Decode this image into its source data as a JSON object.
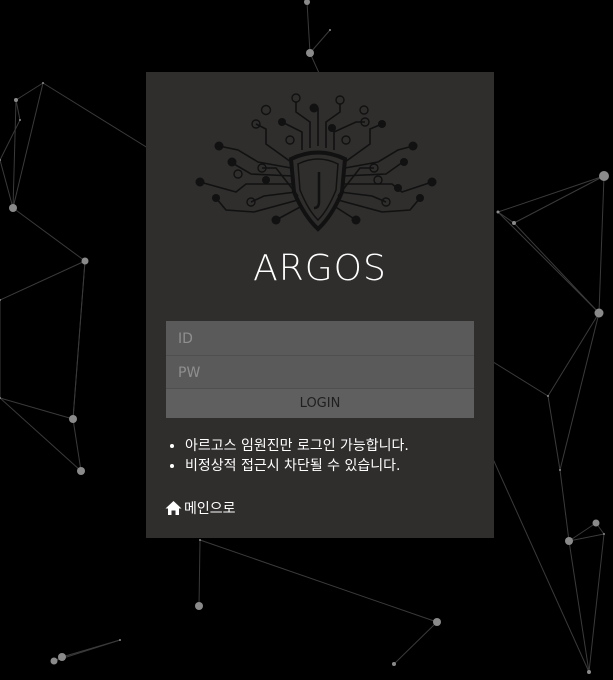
{
  "brand": "ARGOS",
  "login_form": {
    "id_placeholder": "ID",
    "pw_placeholder": "PW",
    "login_label": "LOGIN"
  },
  "notices": [
    "아르고스 임원진만 로그인 가능합니다.",
    "비정상적 접근시 차단될 수 있습니다."
  ],
  "home_link": {
    "icon": "home-icon",
    "label": "메인으로"
  },
  "colors": {
    "page_background": "#000000",
    "panel_background": "#2f2e2d",
    "form_background": "#5a5a5a",
    "text": "#ffffff"
  }
}
